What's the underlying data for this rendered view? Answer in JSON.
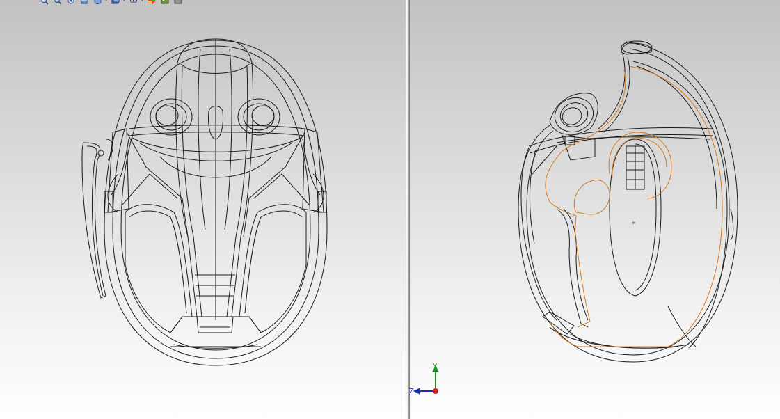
{
  "viewports": [
    {
      "name": "front"
    },
    {
      "name": "side"
    }
  ],
  "toolbar": {
    "icons": [
      "zoom-to-fit-icon",
      "zoom-area-icon",
      "previous-view-icon",
      "section-view-icon",
      "view-orientation-icon",
      "display-style-icon",
      "hide-show-items-icon",
      "edit-appearance-icon",
      "apply-scene-icon",
      "view-settings-icon"
    ]
  },
  "triad": {
    "y_label": "Y",
    "z_label": "Z",
    "colors": {
      "y": "#1f8a1f",
      "z": "#1f2fa8",
      "origin": "#c81e1e"
    }
  },
  "colors": {
    "edge": "#1a1a1a",
    "highlight": "#d4791c",
    "background_top": "#c2c2c2",
    "background_bottom": "#ffffff"
  }
}
